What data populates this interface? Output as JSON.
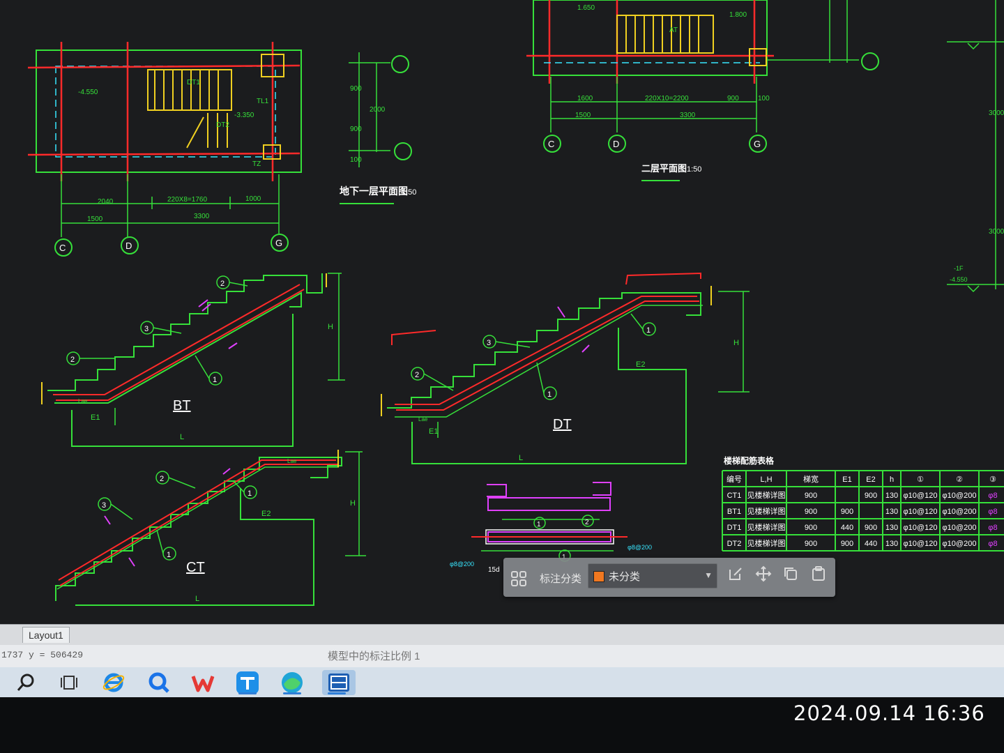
{
  "drawing": {
    "plan1": {
      "title": "地下一层平面图",
      "scale": "1:50",
      "dim_top": [
        "2040",
        "220X8=1760",
        "1000"
      ],
      "dim_bottom": [
        "1500",
        "3300"
      ],
      "dim_right": [
        "900",
        "2000",
        "900",
        "100"
      ],
      "axes": [
        "C",
        "D",
        "G"
      ],
      "stair_labels": [
        "DT1",
        "DT2",
        "TL1",
        "TZ"
      ],
      "levels": [
        "-4.550",
        "-3.350"
      ]
    },
    "plan2": {
      "title": "二层平面图",
      "scale": "1:50",
      "dim_top": [
        "1600",
        "220X10=2200",
        "900",
        "100"
      ],
      "dim_bottom": [
        "1500",
        "3300"
      ],
      "axes": [
        "C",
        "D",
        "G"
      ],
      "stair_labels": [
        "1.650",
        "1.800",
        "AT"
      ]
    },
    "section": {
      "dims": [
        "3000",
        "3000",
        "2000",
        "100"
      ],
      "levels": [
        "-1F",
        "-4.550"
      ]
    },
    "bt": {
      "label": "BT",
      "marks": [
        "1",
        "2",
        "3"
      ],
      "dim_L": "L",
      "dim_H": "H",
      "dim_E1": "E1",
      "lae": "Lae"
    },
    "dt": {
      "label": "DT",
      "marks": [
        "1",
        "2",
        "3"
      ],
      "dim_L": "L",
      "dim_H": "H",
      "dim_E1": "E1",
      "dim_E2": "E2",
      "lae": "Lae"
    },
    "ct": {
      "label": "CT",
      "marks": [
        "1",
        "2",
        "3"
      ],
      "dim_L": "L",
      "dim_H": "H",
      "dim_E2": "E2",
      "lae": "Lae"
    },
    "detail": {
      "marks": [
        "1",
        "2"
      ],
      "rebar_top": "φ8@200",
      "rebar_bottom": "φ8@200",
      "note": "15d"
    },
    "table": {
      "title": "楼梯配筋表格",
      "headers": [
        "编号",
        "L,H",
        "梯宽",
        "E1",
        "E2",
        "h",
        "①",
        "②",
        "③"
      ],
      "rows": [
        [
          "CT1",
          "见楼梯详图",
          "900",
          "",
          "900",
          "130",
          "φ10@120",
          "φ10@200",
          "φ8"
        ],
        [
          "BT1",
          "见楼梯详图",
          "900",
          "900",
          "",
          "130",
          "φ10@120",
          "φ10@200",
          "φ8"
        ],
        [
          "DT1",
          "见楼梯详图",
          "900",
          "440",
          "900",
          "130",
          "φ10@120",
          "φ10@200",
          "φ8"
        ],
        [
          "DT2",
          "见楼梯详图",
          "900",
          "900",
          "440",
          "130",
          "φ10@120",
          "φ10@200",
          "φ8"
        ]
      ]
    }
  },
  "annotation_toolbar": {
    "label": "标注分类",
    "value": "未分类",
    "swatch_color": "#f07820"
  },
  "layout_tab": "Layout1",
  "coords_text": "1737  y = 506429",
  "status_message": "模型中的标注比例 1",
  "watermark": "2024.09.14  16:36",
  "taskbar": [
    "search-icon",
    "task-view-icon",
    "ie-browser-icon",
    "search-app-icon",
    "wps-office-icon",
    "tencent-meeting-icon",
    "edge-browser-icon",
    "cad-app-icon"
  ],
  "colors": {
    "cad_background": "#1b1c1e",
    "line_green": "#36e03a",
    "line_red": "#ff2a2a",
    "line_yellow": "#f0d020",
    "line_cyan": "#38e6ff",
    "line_magenta": "#e040ff"
  }
}
